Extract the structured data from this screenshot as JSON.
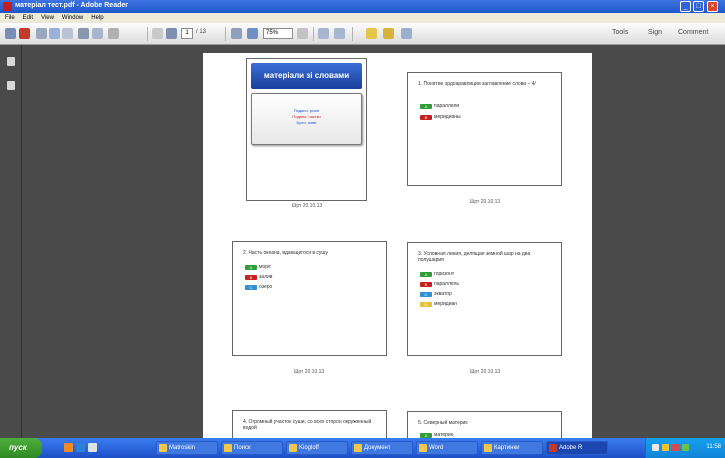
{
  "window": {
    "title": "матеріал тест.pdf - Adobe Reader",
    "controls": [
      "minimize",
      "maximize",
      "close"
    ]
  },
  "menubar": {
    "items": [
      "File",
      "Edit",
      "View",
      "Window",
      "Help"
    ]
  },
  "toolbar": {
    "page_current": "1",
    "page_total": "/ 13",
    "zoom": "75%",
    "tools_label": "Tools",
    "sign_label": "Sign",
    "comment_label": "Comment"
  },
  "document": {
    "cover": {
      "heading": "матеріали зі словами",
      "lines": [
        {
          "text": "Подано: різне",
          "color": "#1f4fc9"
        },
        {
          "text": "Подано: частки",
          "color": "#c62020"
        },
        {
          "text": "Було: нове",
          "color": "#1f4fc9"
        }
      ],
      "caption": "Шрт 20.10.13"
    },
    "slides": [
      {
        "id": "s1",
        "title": "1. Понятие эрдоаравлиции заглавление слова – 4/",
        "caption": "Шрт 20.10.13",
        "options": [
          {
            "tag": "A",
            "label": "параллели",
            "color": "#2f9e3a"
          },
          {
            "tag": "B",
            "label": "меридианы",
            "color": "#c62020"
          }
        ]
      },
      {
        "id": "s2",
        "title": "2. Часть океана, вдающегося в сушу",
        "caption": "Шрт 20.10.13",
        "options": [
          {
            "tag": "A",
            "label": "море",
            "color": "#2f9e3a"
          },
          {
            "tag": "B",
            "label": "залив",
            "color": "#c62020"
          },
          {
            "tag": "C",
            "label": "озеро",
            "color": "#2f8fd0"
          }
        ]
      },
      {
        "id": "s3",
        "title": "3. Условная линия, делящая земной шар на два полушария",
        "caption": "Шрт 20.10.13",
        "options": [
          {
            "tag": "A",
            "label": "горизонт",
            "color": "#2f9e3a"
          },
          {
            "tag": "B",
            "label": "параллель",
            "color": "#c62020"
          },
          {
            "tag": "C",
            "label": "экватор",
            "color": "#2f8fd0"
          },
          {
            "tag": "D",
            "label": "меридиан",
            "color": "#e6c23a"
          }
        ]
      },
      {
        "id": "s4",
        "title": "4. Огромный участок суши, со всех сторон окруженный водой",
        "caption": "",
        "options": []
      },
      {
        "id": "s5",
        "title": "5. Северный материк",
        "caption": "",
        "options": [
          {
            "tag": "A",
            "label": "материк",
            "color": "#2f9e3a"
          }
        ]
      }
    ]
  },
  "taskbar": {
    "start_label": "пуск",
    "items": [
      "Matroskin",
      "Поиск",
      "Kiogloff",
      "Документ",
      "Word",
      "Картинки",
      "Adobe R"
    ],
    "clock": "11:58"
  },
  "colors": {
    "titlebar": "#1f55cc",
    "taskbar": "#2a63d8",
    "start": "#3a9a2e",
    "cover_heading": "#1a3f9a",
    "doc_background": "#4b4b4b"
  }
}
